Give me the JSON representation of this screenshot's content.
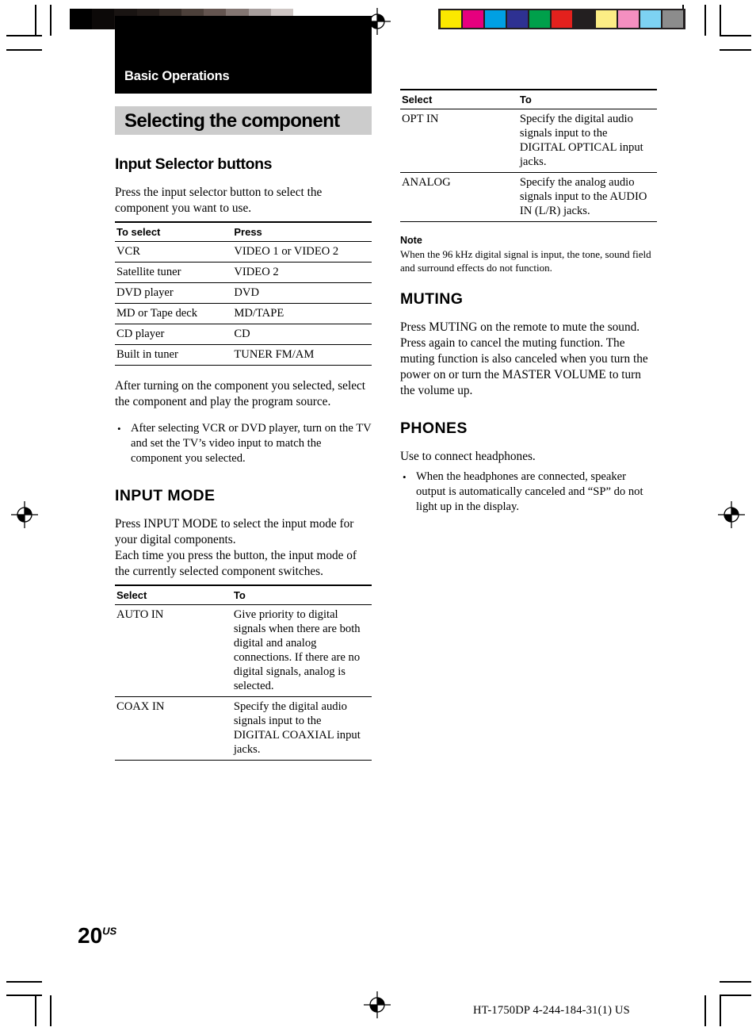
{
  "document": {
    "chapter": "Basic Operations",
    "page_title": "Selecting the component",
    "page_number": "20",
    "page_number_suffix": "US",
    "footer_code": "HT-1750DP   4-244-184-31(1) US"
  },
  "calibration": {
    "gray_wedge": [
      "#000000",
      "#0c0908",
      "#191412",
      "#231c19",
      "#342b26",
      "#4c403a",
      "#645550",
      "#837672",
      "#a79e9c",
      "#cec6c4",
      "#ffffff"
    ],
    "color_wedge": [
      "#fbe800",
      "#e6007e",
      "#00a0e3",
      "#2e3192",
      "#00a04b",
      "#e3211d",
      "#231f20",
      "#fced85",
      "#f48fc0",
      "#7dd2f2",
      "#8c8c8c"
    ],
    "color_wedge_frame": "#231f20"
  },
  "left_column": {
    "section1": {
      "heading": "Input Selector buttons",
      "intro": "Press the input selector button to select the component you want to use.",
      "table": {
        "headers": [
          "To select",
          "Press"
        ],
        "rows": [
          [
            "VCR",
            "VIDEO 1 or VIDEO 2"
          ],
          [
            "Satellite tuner",
            "VIDEO 2"
          ],
          [
            "DVD player",
            "DVD"
          ],
          [
            "MD or Tape deck",
            "MD/TAPE"
          ],
          [
            "CD player",
            "CD"
          ],
          [
            "Built in tuner",
            "TUNER FM/AM"
          ]
        ]
      },
      "after_text": "After turning on the component you selected, select the component and play the program source.",
      "bullets": [
        "After selecting VCR or DVD player, turn on the TV and set the TV’s video input to match the component you selected."
      ]
    },
    "section2": {
      "heading": "INPUT MODE",
      "para1": "Press INPUT MODE to select the input mode for your digital components.",
      "para2": "Each time you press the button, the input mode of the currently selected component switches.",
      "table": {
        "headers": [
          "Select",
          "To"
        ],
        "rows": [
          [
            "AUTO IN",
            "Give priority to digital signals when there are both digital and analog connections. If there are no digital signals, analog is selected."
          ],
          [
            "COAX IN",
            "Specify the digital audio signals input to the DIGITAL COAXIAL input jacks."
          ]
        ]
      }
    }
  },
  "right_column": {
    "table_continued": {
      "headers": [
        "Select",
        "To"
      ],
      "rows": [
        [
          "OPT IN",
          "Specify the digital audio signals input to the DIGITAL OPTICAL input jacks."
        ],
        [
          "ANALOG",
          "Specify the analog audio signals input to the AUDIO IN (L/R) jacks."
        ]
      ]
    },
    "note": {
      "label": "Note",
      "text": "When the 96 kHz digital signal is input, the tone, sound field and surround effects do not function."
    },
    "section_muting": {
      "heading": "MUTING",
      "text": "Press MUTING on the remote to mute the sound. Press again to cancel the muting function. The muting function is also canceled when you turn the power on or turn the MASTER VOLUME to turn the volume up."
    },
    "section_phones": {
      "heading": "PHONES",
      "text": "Use to connect headphones.",
      "bullets": [
        "When the headphones are connected, speaker output is automatically canceled and “SP” do not light up in the display."
      ]
    }
  }
}
